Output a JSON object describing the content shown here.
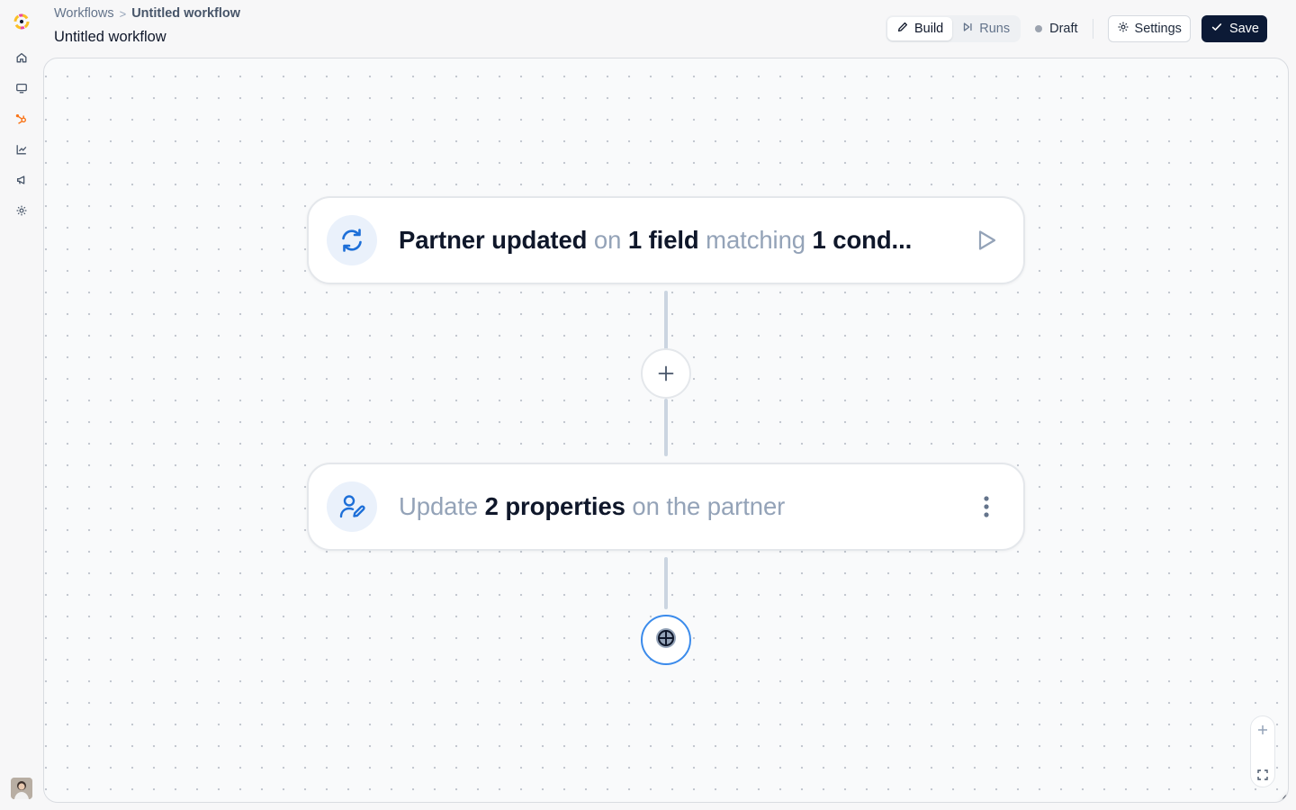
{
  "breadcrumb": {
    "parent": "Workflows",
    "separator": ">",
    "current": "Untitled workflow"
  },
  "page_title": "Untitled workflow",
  "toolbar": {
    "build_label": "Build",
    "runs_label": "Runs",
    "status_label": "Draft",
    "settings_label": "Settings",
    "save_label": "Save"
  },
  "nav": {
    "items": [
      "home-icon",
      "monitor-icon",
      "hubspot-icon",
      "chart-icon",
      "megaphone-icon",
      "gear-icon"
    ]
  },
  "nodes": {
    "trigger": {
      "w1": "Partner updated",
      "w2": "on",
      "w3": "1 field",
      "w4": "matching",
      "w5": "1 cond...",
      "icon": "refresh-icon",
      "action_icon": "play-icon"
    },
    "action": {
      "w1": "Update",
      "w2": "2 properties",
      "w3": "on the partner",
      "icon": "user-edit-icon",
      "action_icon": "more-vertical-icon"
    }
  },
  "colors": {
    "accent": "#1d6fd8",
    "save_bg": "#0c1a36",
    "brand": "#f97316"
  }
}
